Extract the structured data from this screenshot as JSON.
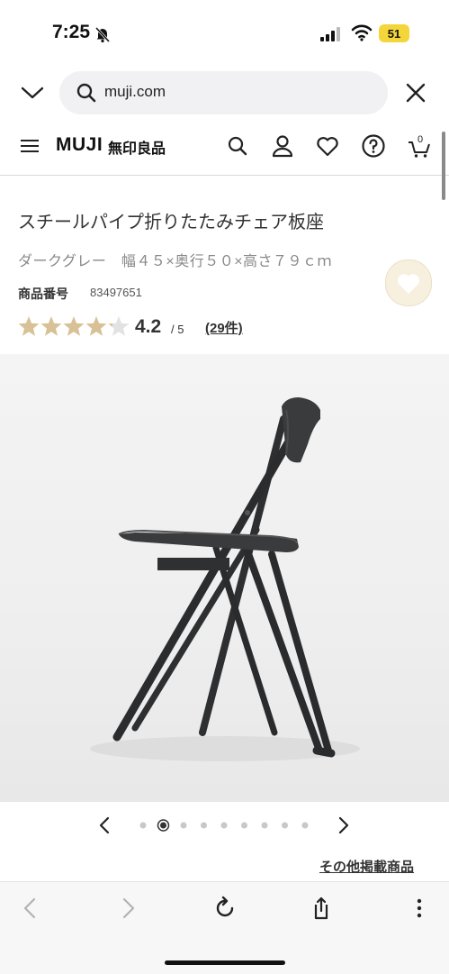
{
  "status_bar": {
    "time": "7:25",
    "battery": "51"
  },
  "browser": {
    "url": "muji.com"
  },
  "site": {
    "logo": "MUJI",
    "logo_jp": "無印良品",
    "cart_count": "0"
  },
  "product": {
    "title": "スチールパイプ折りたたみチェア板座",
    "subtitle": "ダークグレー　幅４５×奥行５０×高さ７９ｃｍ",
    "number_label": "商品番号",
    "number": "83497651",
    "rating": "4.2",
    "rating_max": "/ 5",
    "rating_fraction": 0.84,
    "review_link": "(29件)"
  },
  "carousel": {
    "dot_count": 9,
    "active_index": 1
  },
  "links": {
    "other_products": "その他掲載商品"
  },
  "colors": {
    "star": "#d8c197",
    "star_empty": "#e2e2e2",
    "fav_bg": "#f7f0df"
  },
  "icons": {
    "header": [
      "search-icon",
      "user-icon",
      "heart-icon",
      "help-icon",
      "cart-icon"
    ],
    "bottom": [
      "back-icon",
      "forward-icon",
      "reload-icon",
      "share-icon",
      "more-icon"
    ]
  }
}
